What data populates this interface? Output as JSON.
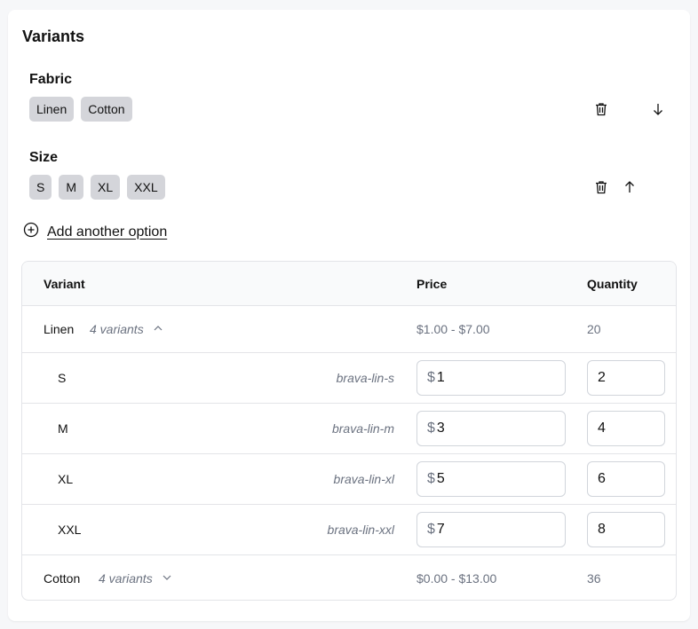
{
  "title": "Variants",
  "options": [
    {
      "name": "Fabric",
      "values": [
        "Linen",
        "Cotton"
      ]
    },
    {
      "name": "Size",
      "values": [
        "S",
        "M",
        "XL",
        "XXL"
      ]
    }
  ],
  "add_option_label": "Add another option",
  "table": {
    "headers": {
      "variant": "Variant",
      "price": "Price",
      "quantity": "Quantity"
    },
    "groups": [
      {
        "name": "Linen",
        "count": "4 variants",
        "price_range": "$1.00 - $7.00",
        "quantity": "20",
        "expanded": true,
        "variants": [
          {
            "name": "S",
            "sku": "brava-lin-s",
            "currency": "$",
            "price": "1",
            "quantity": "2"
          },
          {
            "name": "M",
            "sku": "brava-lin-m",
            "currency": "$",
            "price": "3",
            "quantity": "4"
          },
          {
            "name": "XL",
            "sku": "brava-lin-xl",
            "currency": "$",
            "price": "5",
            "quantity": "6"
          },
          {
            "name": "XXL",
            "sku": "brava-lin-xxl",
            "currency": "$",
            "price": "7",
            "quantity": "8"
          }
        ]
      },
      {
        "name": "Cotton",
        "count": "4 variants",
        "price_range": "$0.00 - $13.00",
        "quantity": "36",
        "expanded": false
      }
    ]
  }
}
